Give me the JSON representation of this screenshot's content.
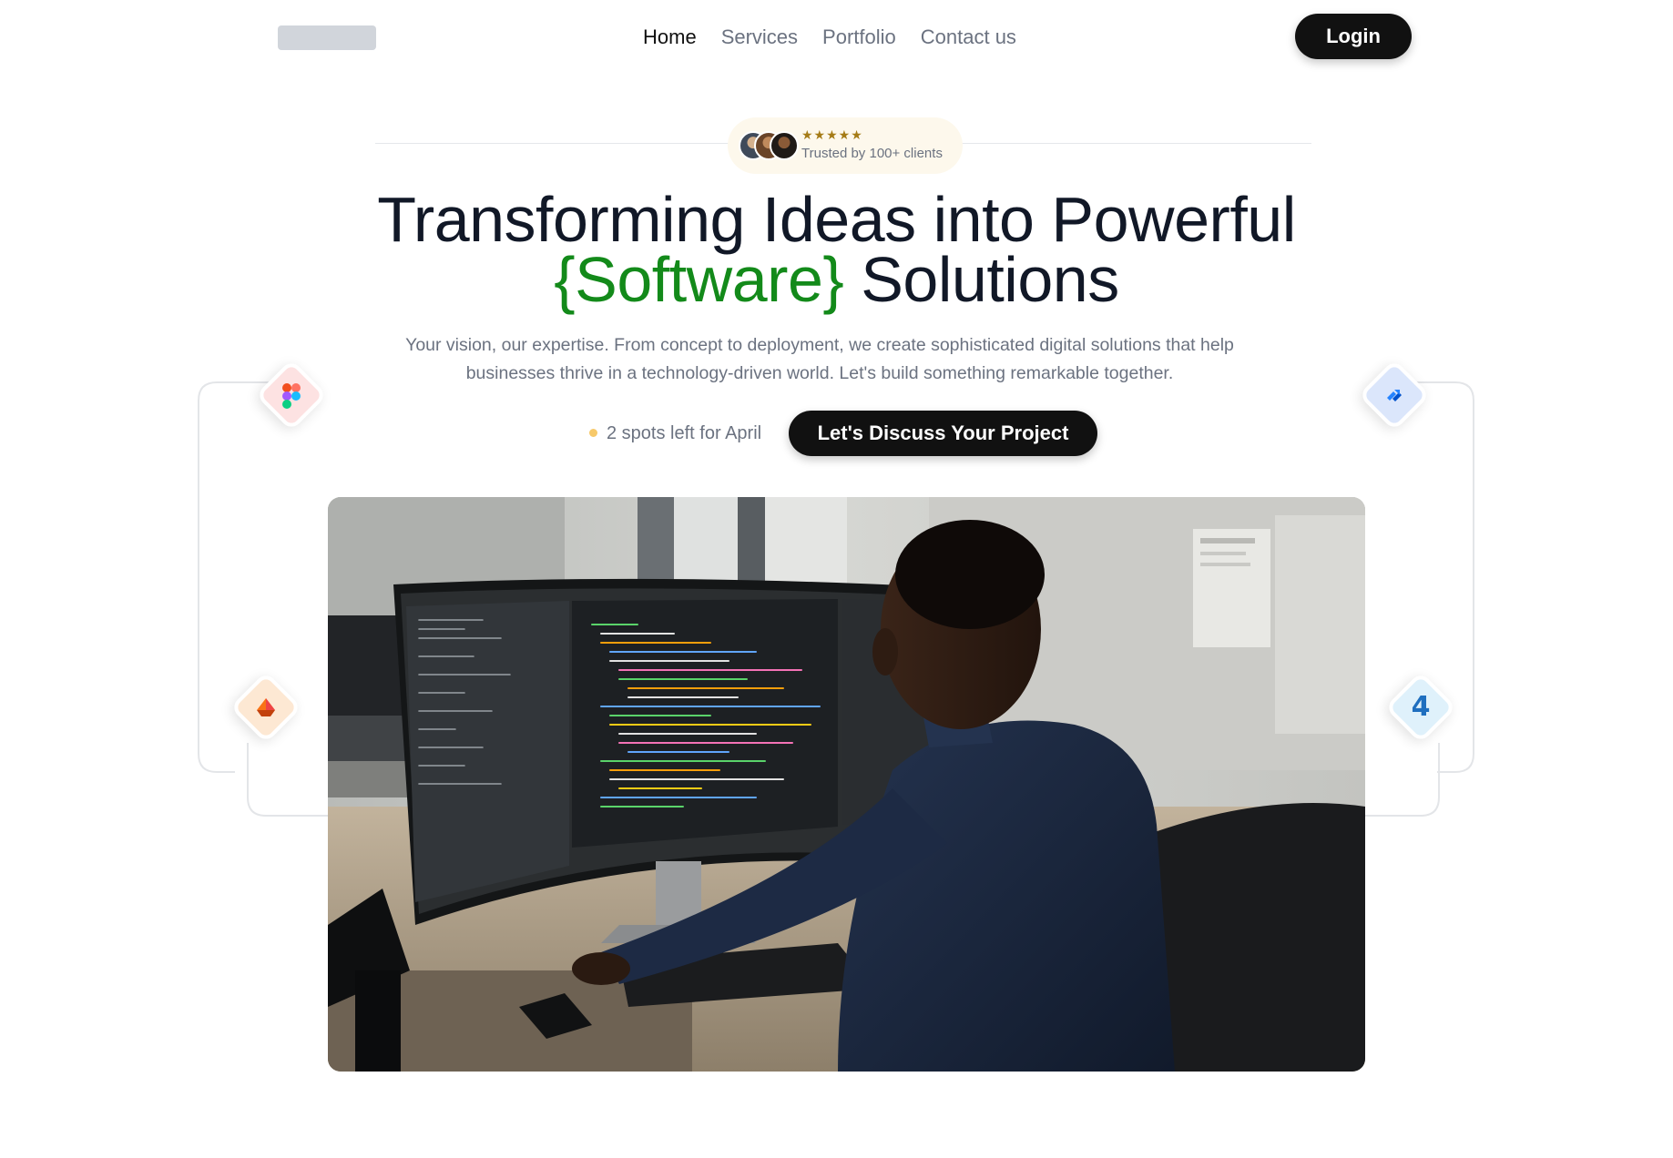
{
  "nav": {
    "items": [
      {
        "label": "Home",
        "active": true
      },
      {
        "label": "Services",
        "active": false
      },
      {
        "label": "Portfolio",
        "active": false
      },
      {
        "label": "Contact us",
        "active": false
      }
    ],
    "login_label": "Login"
  },
  "trust": {
    "stars": "★★★★★",
    "text": "Trusted by 100+ clients"
  },
  "hero": {
    "headline_line1": "Transforming Ideas into Powerful",
    "headline_accent": "{Software}",
    "headline_line2_rest": " Solutions",
    "subtext": "Your vision, our expertise. From concept to deployment, we create sophisticated digital solutions that help businesses thrive in a technology-driven world. Let's build something remarkable together.",
    "availability": "2 spots left for April",
    "cta_label": "Let's Discuss Your Project"
  },
  "tool_icons": [
    "figma-icon",
    "jira-icon",
    "ship-icon",
    "four-icon"
  ],
  "four_icon_text": "4",
  "colors": {
    "accent_green": "#138a1a",
    "button_black": "#111111",
    "availability_dot": "#f7c96a",
    "muted_text": "#6b7280"
  }
}
